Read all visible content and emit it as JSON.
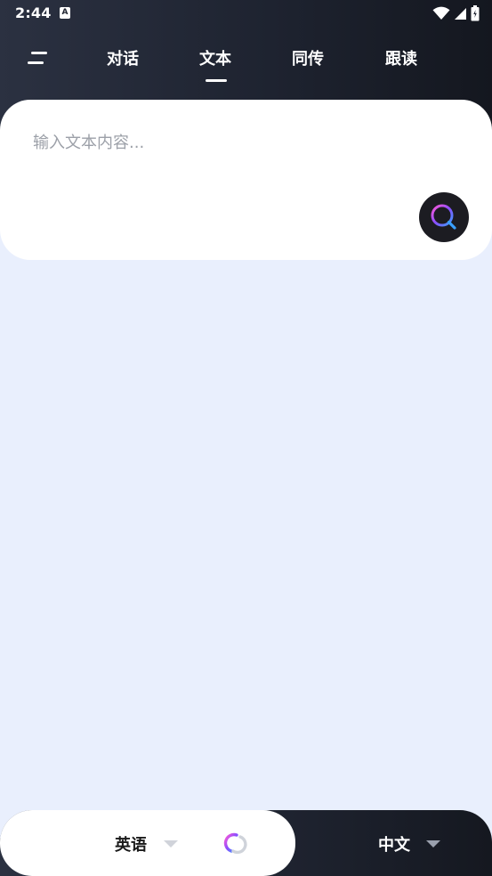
{
  "status_bar": {
    "time": "2:44",
    "notification_icon_letter": "A",
    "icons": [
      "wifi-icon",
      "signal-icon",
      "battery-icon"
    ]
  },
  "header": {
    "menu_icon": "menu-icon",
    "tabs": [
      {
        "label": "对话",
        "selected": false
      },
      {
        "label": "文本",
        "selected": true
      },
      {
        "label": "同传",
        "selected": false
      },
      {
        "label": "跟读",
        "selected": false
      }
    ]
  },
  "input": {
    "value": "",
    "placeholder": "输入文本内容..."
  },
  "search_button": {
    "icon": "search-icon"
  },
  "language_bar": {
    "source_language": "英语",
    "target_language": "中文",
    "swap_icon": "swap-icon",
    "dropdown_icon": "caret-down-icon"
  },
  "colors": {
    "header_dark": "#1e2330",
    "content_bg": "#e9effd",
    "card_bg": "#ffffff",
    "search_button_bg": "#1c1c22",
    "accent_purple": "#8a4dff",
    "accent_blue": "#3aa0ff",
    "accent_pink": "#ff5ad6"
  }
}
